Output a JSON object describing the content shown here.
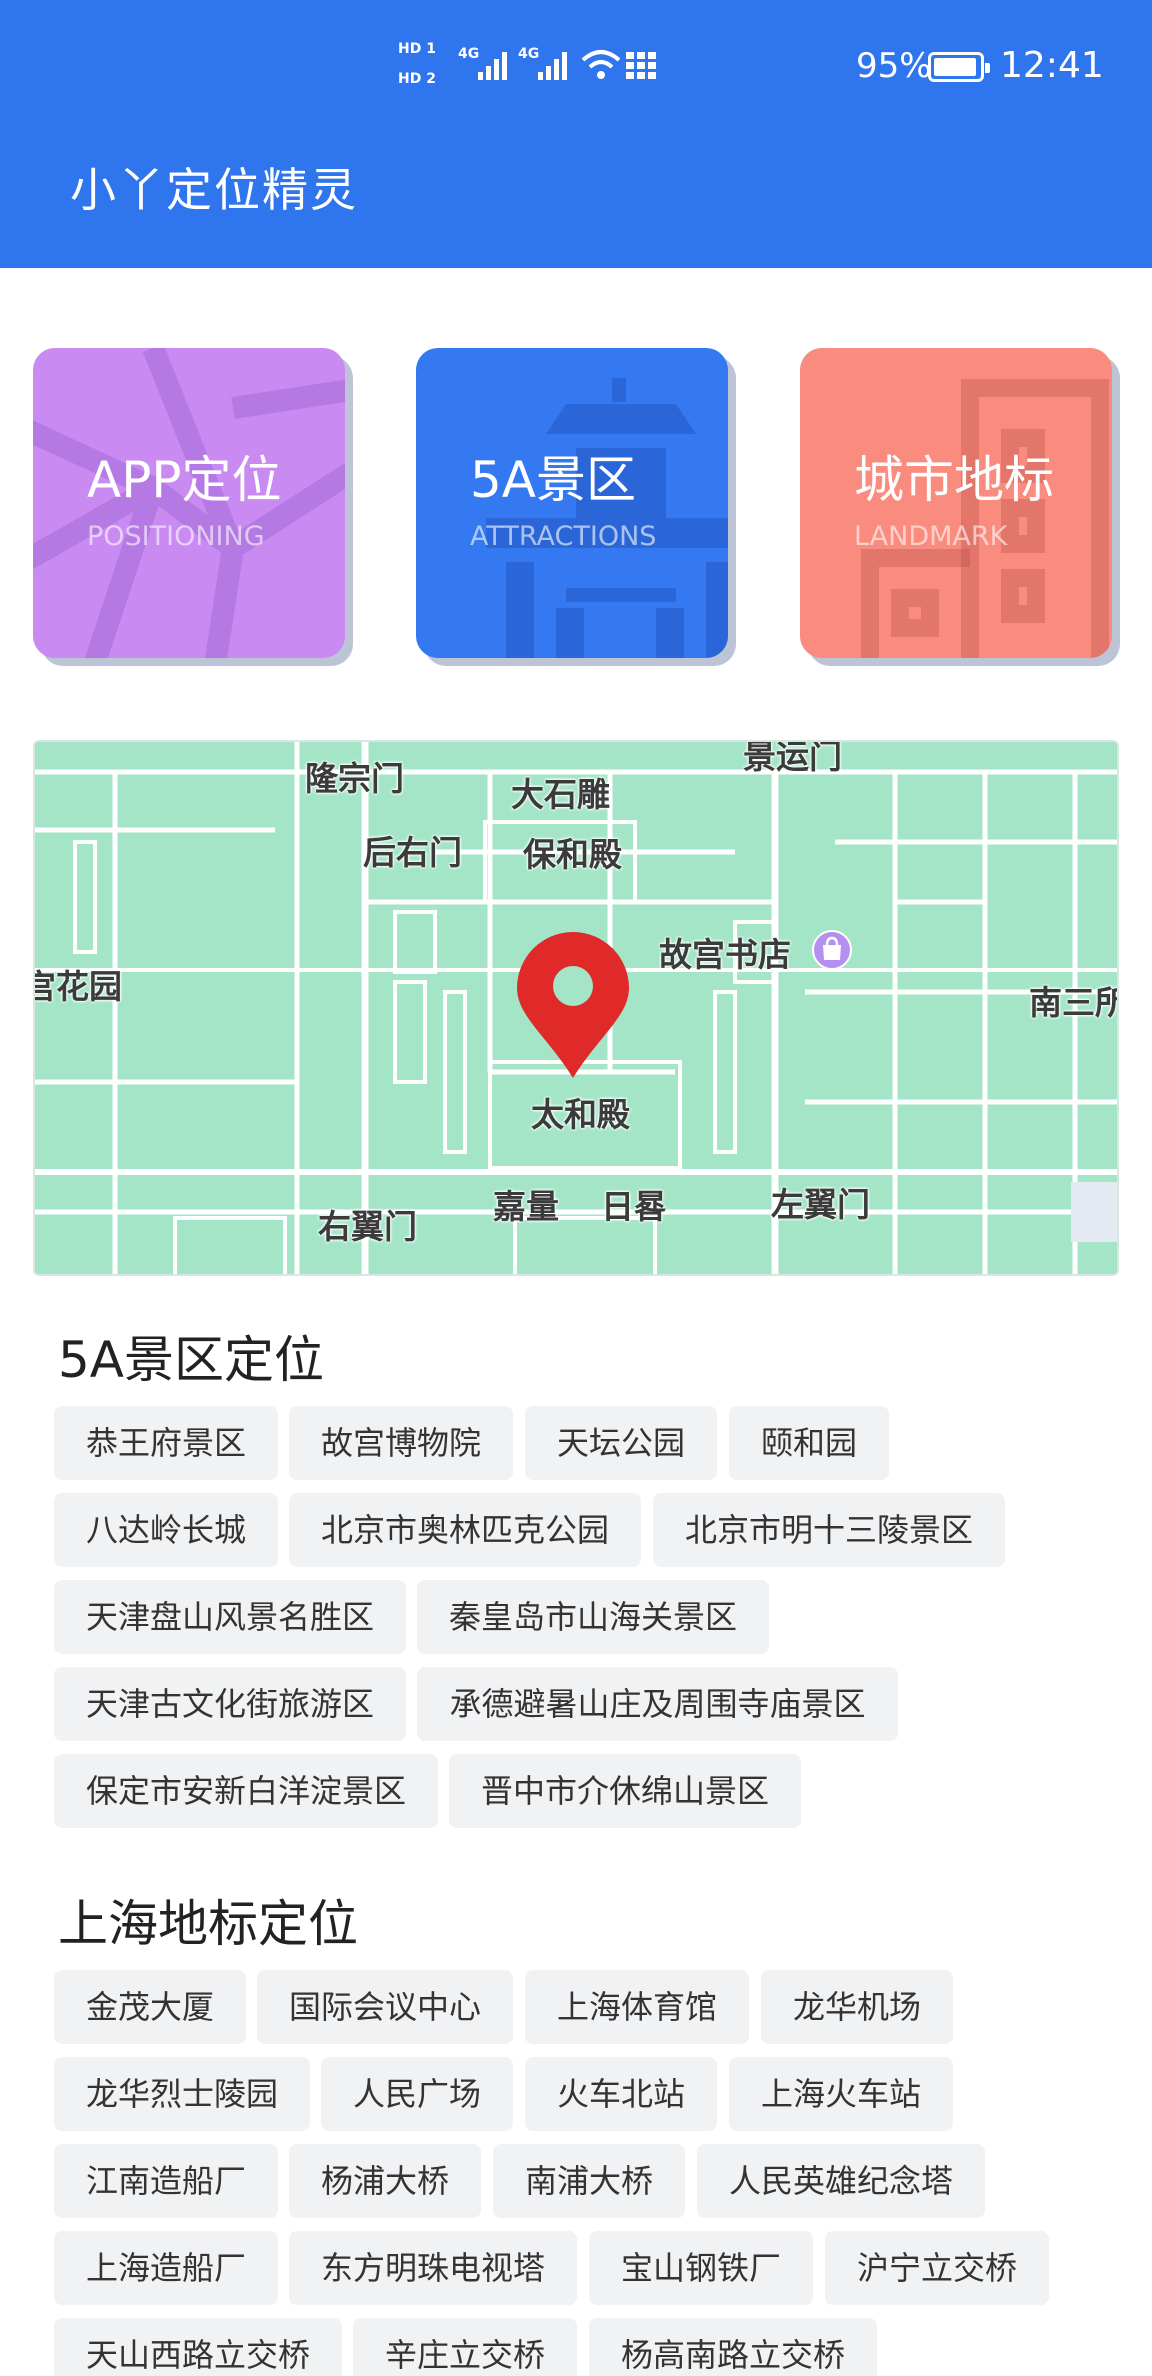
{
  "status_bar": {
    "hd1": "HD 1",
    "hd2": "HD 2",
    "net1": "4G",
    "net2": "4G",
    "battery_percent": "95%",
    "battery_level": 0.95,
    "time": "12:41"
  },
  "header": {
    "title": "小丫定位精灵",
    "color": "#2f76ee"
  },
  "categories": [
    {
      "title": "APP定位",
      "subtitle": "POSITIONING",
      "color": "#c98af2"
    },
    {
      "title": "5A景区",
      "subtitle": "ATTRACTIONS",
      "color": "#3479f2"
    },
    {
      "title": "城市地标",
      "subtitle": "LANDMARK",
      "color": "#fa8b7f"
    }
  ],
  "map": {
    "labels": [
      "隆宗门",
      "大石雕",
      "景运门",
      "后右门",
      "保和殿",
      "故宫书店",
      "宫花园",
      "南三所",
      "太和殿",
      "右翼门",
      "嘉量",
      "日晷",
      "左翼门"
    ],
    "pin_color": "#e02a2a"
  },
  "sections": [
    {
      "title": "5A景区定位",
      "items": [
        "恭王府景区",
        "故宫博物院",
        "天坛公园",
        "颐和园",
        "八达岭长城",
        "北京市奥林匹克公园",
        "北京市明十三陵景区",
        "天津盘山风景名胜区",
        "秦皇岛市山海关景区",
        "天津古文化街旅游区",
        "承德避暑山庄及周围寺庙景区",
        "保定市安新白洋淀景区",
        "晋中市介休绵山景区"
      ]
    },
    {
      "title": "上海地标定位",
      "items": [
        "金茂大厦",
        "国际会议中心",
        "上海体育馆",
        "龙华机场",
        "龙华烈士陵园",
        "人民广场",
        "火车北站",
        "上海火车站",
        "江南造船厂",
        "杨浦大桥",
        "南浦大桥",
        "人民英雄纪念塔",
        "上海造船厂",
        "东方明珠电视塔",
        "宝山钢铁厂",
        "沪宁立交桥",
        "天山西路立交桥",
        "辛庄立交桥",
        "杨高南路立交桥"
      ]
    }
  ]
}
